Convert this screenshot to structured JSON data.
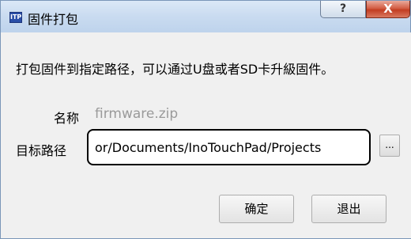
{
  "window": {
    "title": "固件打包",
    "app_icon_text": "ITP",
    "help_label": "?",
    "close_label": "X"
  },
  "dialog": {
    "description": "打包固件到指定路径，可以通过U盘或者SD卡升級固件。",
    "name_label": "名称",
    "name_value": "firmware.zip",
    "target_label": "目标路径",
    "target_value": "or/Documents/InoTouchPad/Projects",
    "browse_label": "...",
    "ok_label": "确定",
    "exit_label": "退出"
  }
}
